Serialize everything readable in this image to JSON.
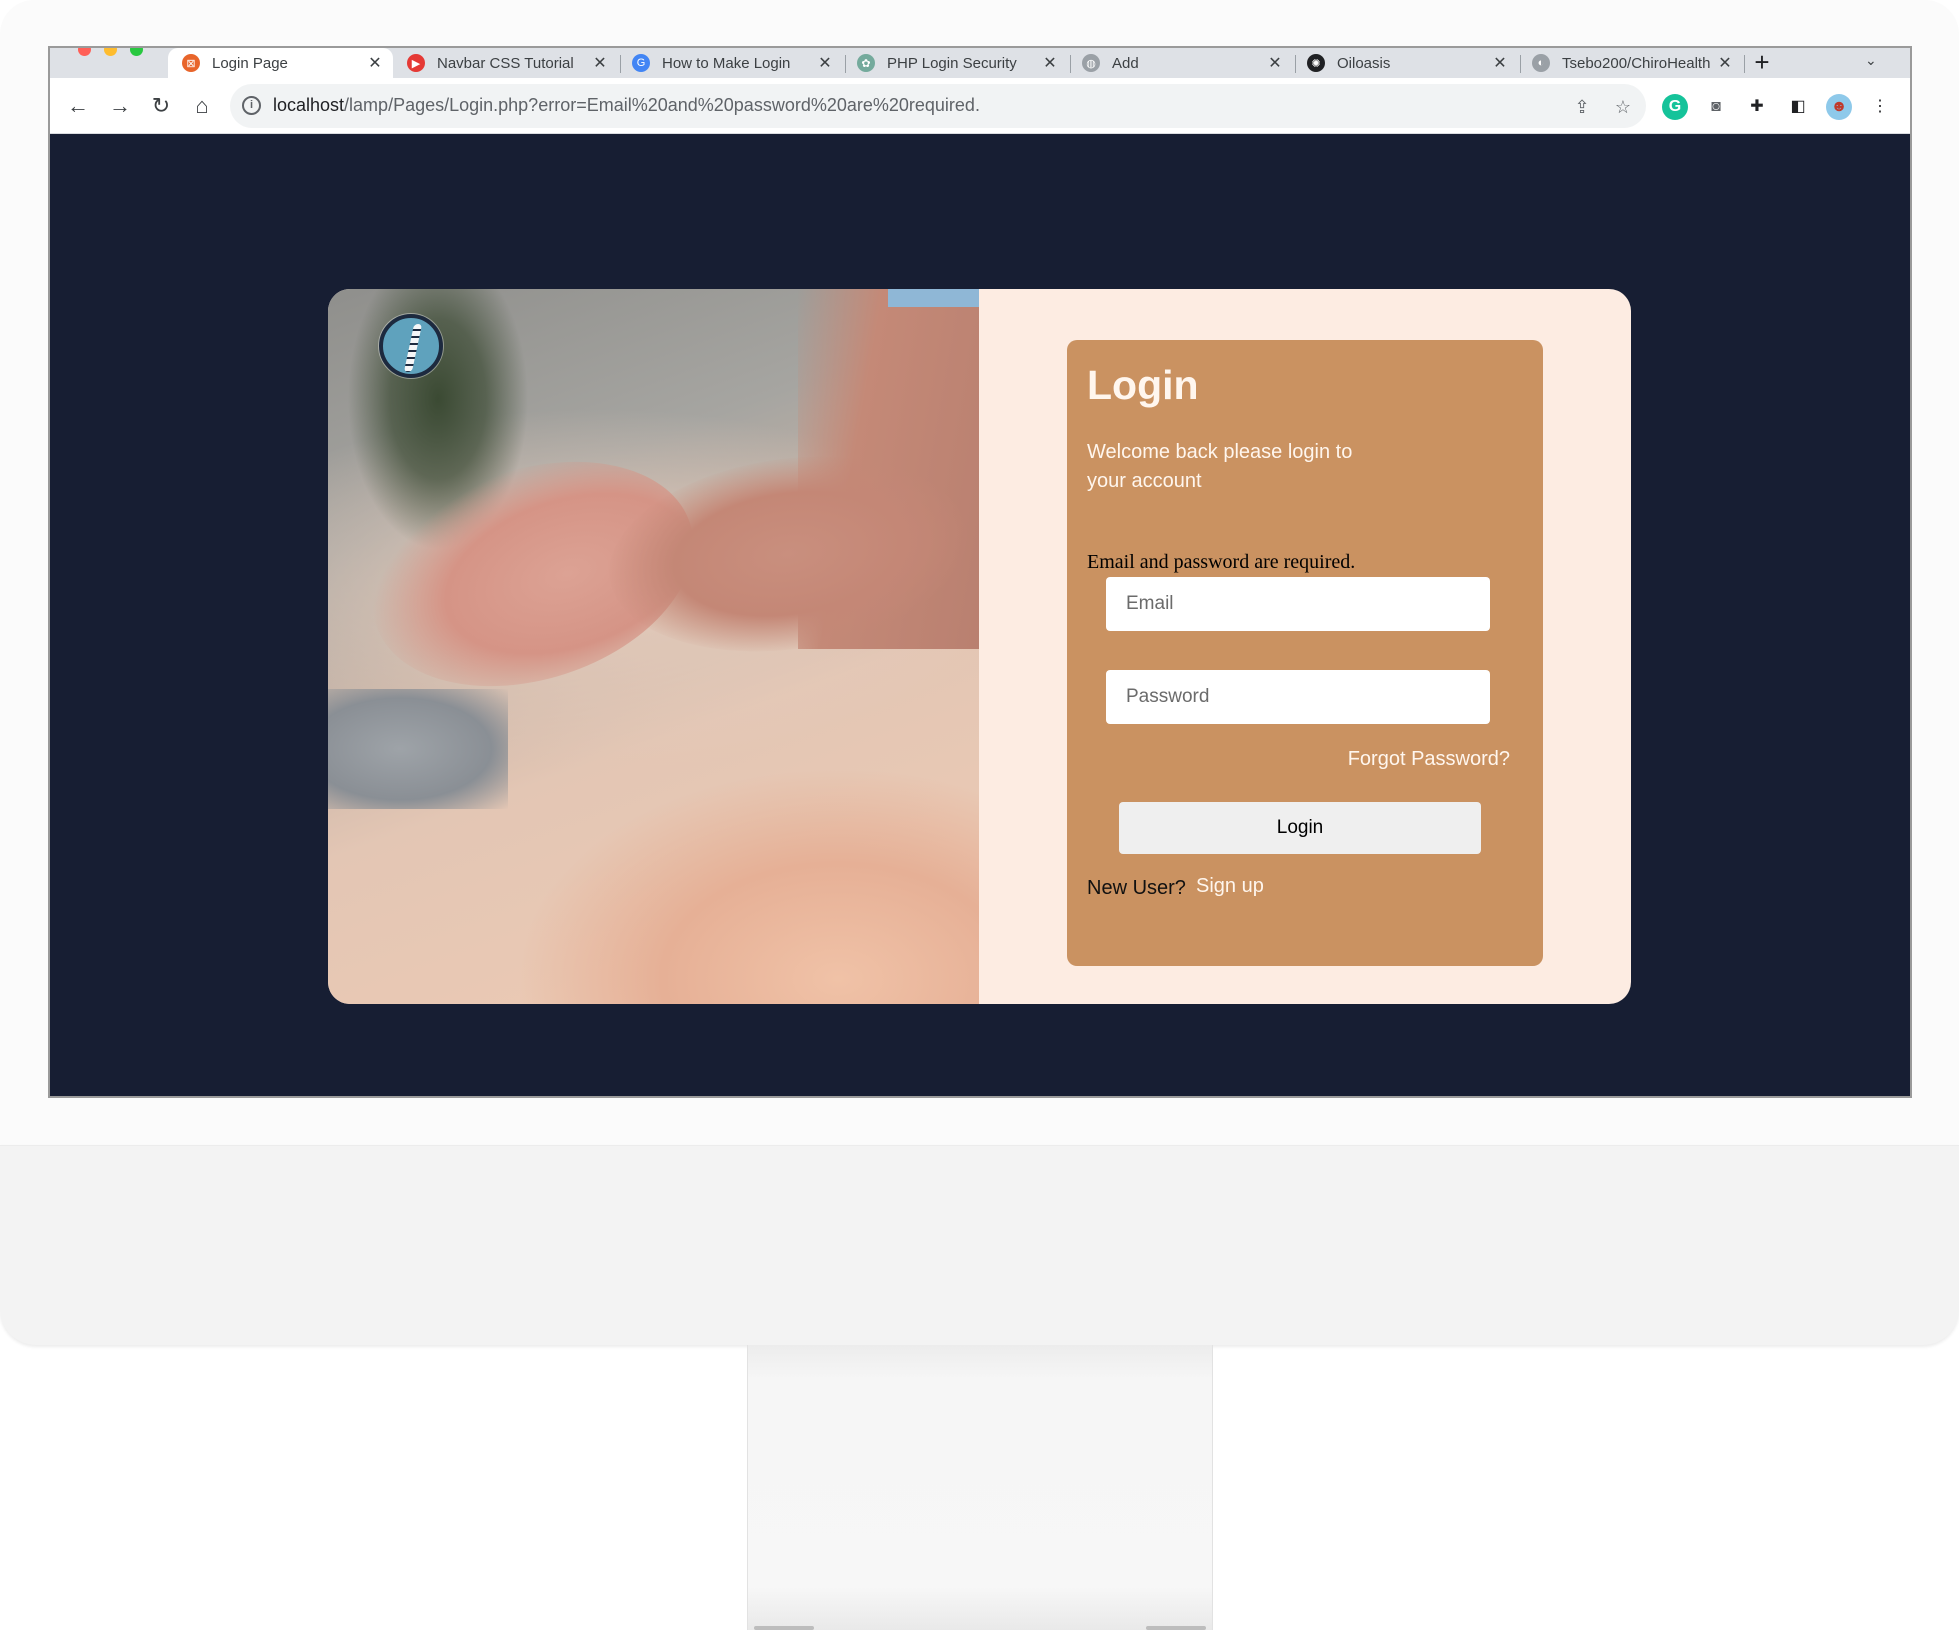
{
  "browser": {
    "tabs": [
      {
        "title": "Login Page",
        "favicon_color": "#e8652b",
        "active": true
      },
      {
        "title": "Navbar CSS Tutorial",
        "favicon_color": "#e53935",
        "active": false
      },
      {
        "title": "How to Make Login",
        "favicon_color": "#4285f4",
        "active": false
      },
      {
        "title": "PHP Login Security",
        "favicon_color": "#74aa9c",
        "active": false
      },
      {
        "title": "Add",
        "favicon_color": "#9aa0a6",
        "active": false
      },
      {
        "title": "Oiloasis",
        "favicon_color": "#202124",
        "active": false
      },
      {
        "title": "Tsebo200/ChiroHealth",
        "favicon_color": "#9aa0a6",
        "active": false
      }
    ],
    "close_glyph": "✕",
    "new_tab_glyph": "+",
    "tab_list_glyph": "⌄",
    "url_host": "localhost",
    "url_path": "/lamp/Pages/Login.php?error=Email%20and%20password%20are%20required.",
    "icons": [
      "back-icon",
      "forward-icon",
      "reload-icon",
      "home-icon",
      "info-icon",
      "share-icon",
      "bookmark-star-icon",
      "grammarly-icon",
      "camera-icon",
      "extensions-icon",
      "side-panel-icon",
      "profile-avatar-icon",
      "menu-icon"
    ]
  },
  "login": {
    "title": "Login",
    "subtitle": "Welcome back please login to your account",
    "error": "Email and password are required.",
    "email_placeholder": "Email",
    "password_placeholder": "Password",
    "forgot_label": "Forgot Password?",
    "button_label": "Login",
    "new_user_label": "New User?",
    "signup_label": "Sign up"
  },
  "colors": {
    "page_background": "#171e33",
    "card_background": "#fdece2",
    "login_panel": "#ca9261",
    "button": "#efefef"
  }
}
